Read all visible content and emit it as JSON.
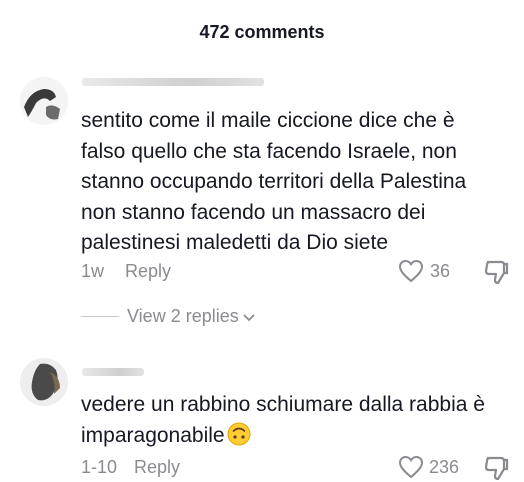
{
  "header": {
    "title": "472 comments"
  },
  "comments": [
    {
      "lines": [
        "sentito come il maile ciccione dice che è",
        "falso quello che sta facendo Israele, non",
        "stanno occupando territori della Palestina",
        "non stanno facendo un massacro dei",
        "palestinesi maledetti da Dio siete"
      ],
      "time": "1w",
      "reply_label": "Reply",
      "likes": "36",
      "view_replies": "View 2 replies"
    },
    {
      "lines": [
        "vedere un rabbino schiumare dalla rabbia è",
        "imparagonabile"
      ],
      "emoji": "upside-down-face-emoji",
      "time": "1-10",
      "reply_label": "Reply",
      "likes": "236"
    }
  ]
}
